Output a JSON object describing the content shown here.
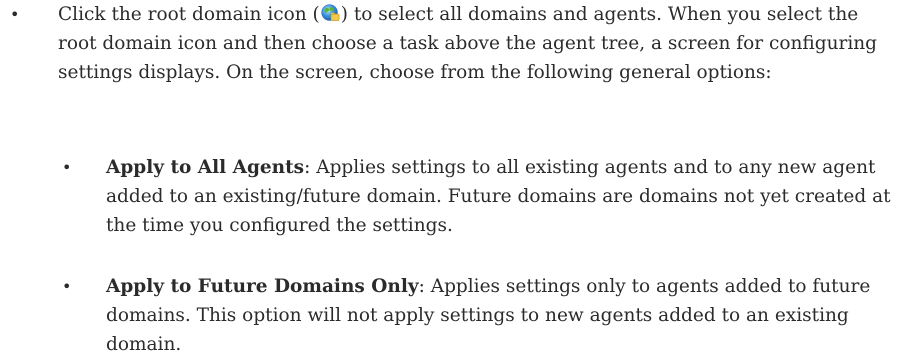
{
  "bullet_symbol": "•",
  "paragraph": {
    "before_icon": "Click the root domain icon (",
    "icon": "root-domain-icon",
    "after_icon": ") to select all domains and agents. When you select the root domain icon and then choose a task above the agent tree, a screen for configuring settings displays. On the screen, choose from the following general options:"
  },
  "options": [
    {
      "title": "Apply to All Agents",
      "description": ": Applies settings to all existing agents and to any new agent added to an existing/future domain. Future domains are domains not yet created at the time you configured the settings."
    },
    {
      "title": "Apply to Future Domains Only",
      "description": ": Applies settings only to agents added to future domains. This option will not apply settings to new agents added to an existing domain."
    }
  ]
}
